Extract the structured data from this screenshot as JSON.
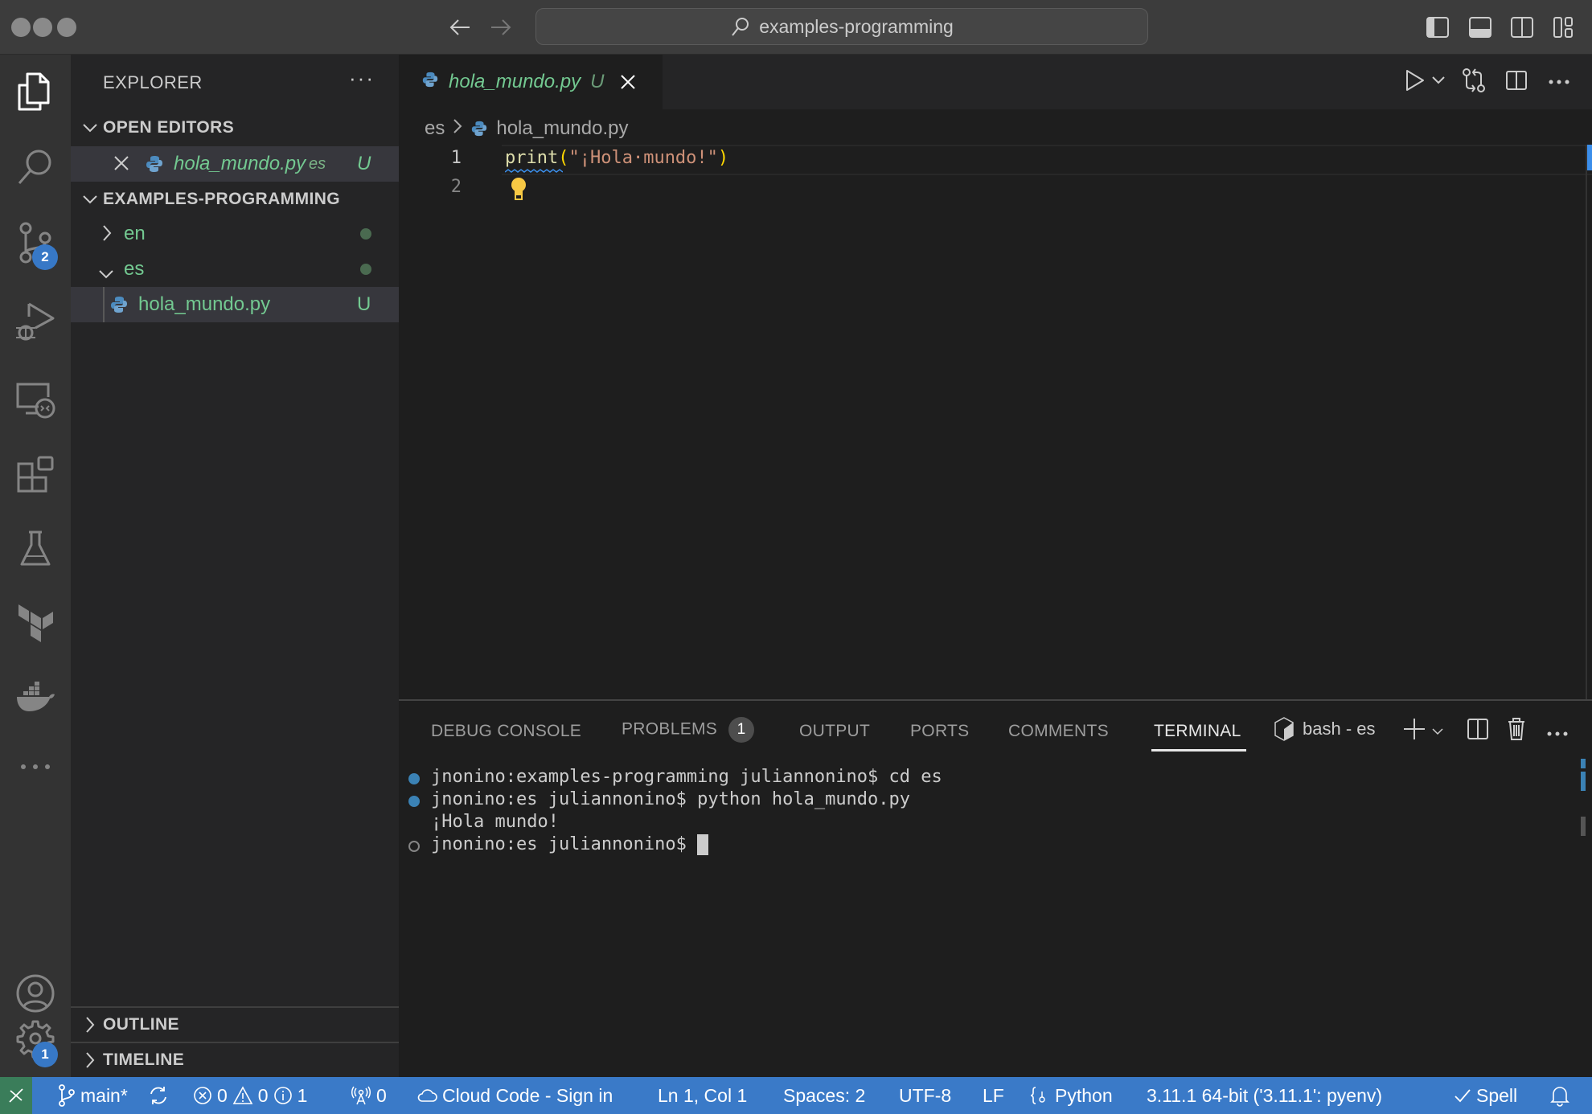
{
  "titlebar": {
    "command_center": "examples-programming"
  },
  "activity_bar": {
    "items": [
      {
        "name": "explorer",
        "active": true
      },
      {
        "name": "search"
      },
      {
        "name": "source-control",
        "badge": "2"
      },
      {
        "name": "run-and-debug"
      },
      {
        "name": "remote-explorer"
      },
      {
        "name": "extensions"
      },
      {
        "name": "testing"
      },
      {
        "name": "terraform"
      },
      {
        "name": "docker"
      },
      {
        "name": "more"
      }
    ],
    "accounts_badge": null,
    "settings_badge": "1"
  },
  "sidebar": {
    "title": "EXPLORER",
    "more": "···",
    "open_editors": {
      "label": "OPEN EDITORS",
      "items": [
        {
          "filename": "hola_mundo.py",
          "folder": "es",
          "status": "U"
        }
      ]
    },
    "workspace": {
      "label": "EXAMPLES-PROGRAMMING",
      "tree": [
        {
          "name": "en",
          "type": "folder",
          "expanded": false
        },
        {
          "name": "es",
          "type": "folder",
          "expanded": true
        },
        {
          "name": "hola_mundo.py",
          "type": "file",
          "status": "U"
        }
      ]
    },
    "outline_label": "OUTLINE",
    "timeline_label": "TIMELINE"
  },
  "editor": {
    "tab": {
      "filename": "hola_mundo.py",
      "status": "U"
    },
    "breadcrumb": {
      "folder": "es",
      "file": "hola_mundo.py"
    },
    "lines": [
      {
        "number": "1",
        "fn": "print",
        "open": "(",
        "string": "\"¡Hola·mundo!\"",
        "close": ")"
      },
      {
        "number": "2"
      }
    ]
  },
  "panel": {
    "tabs": [
      {
        "label": "DEBUG CONSOLE"
      },
      {
        "label": "PROBLEMS",
        "badge": "1"
      },
      {
        "label": "OUTPUT"
      },
      {
        "label": "PORTS"
      },
      {
        "label": "COMMENTS"
      },
      {
        "label": "TERMINAL",
        "active": true
      }
    ],
    "terminal_name": "bash - es",
    "terminal_lines": [
      {
        "mark": "success",
        "text": "jnonino:examples-programming juliannonino$ cd es"
      },
      {
        "mark": "success",
        "text": "jnonino:es juliannonino$ python hola_mundo.py"
      },
      {
        "mark": "none",
        "text": "¡Hola mundo!"
      },
      {
        "mark": "empty",
        "text": "jnonino:es juliannonino$ "
      }
    ]
  },
  "statusbar": {
    "branch": "main*",
    "errors": "0",
    "warnings": "0",
    "infos": "1",
    "ports": "0",
    "cloud_code": "Cloud Code - Sign in",
    "position": "Ln 1, Col 1",
    "indent": "Spaces: 2",
    "encoding": "UTF-8",
    "eol": "LF",
    "language": "Python",
    "interpreter": "3.11.1 64-bit ('3.11.1': pyenv)",
    "spell": "Spell"
  },
  "colors": {
    "statusbar": "#3a7ac8",
    "remote": "#3a7d5a",
    "git_untracked": "#73c991",
    "badge": "#3778c6"
  }
}
